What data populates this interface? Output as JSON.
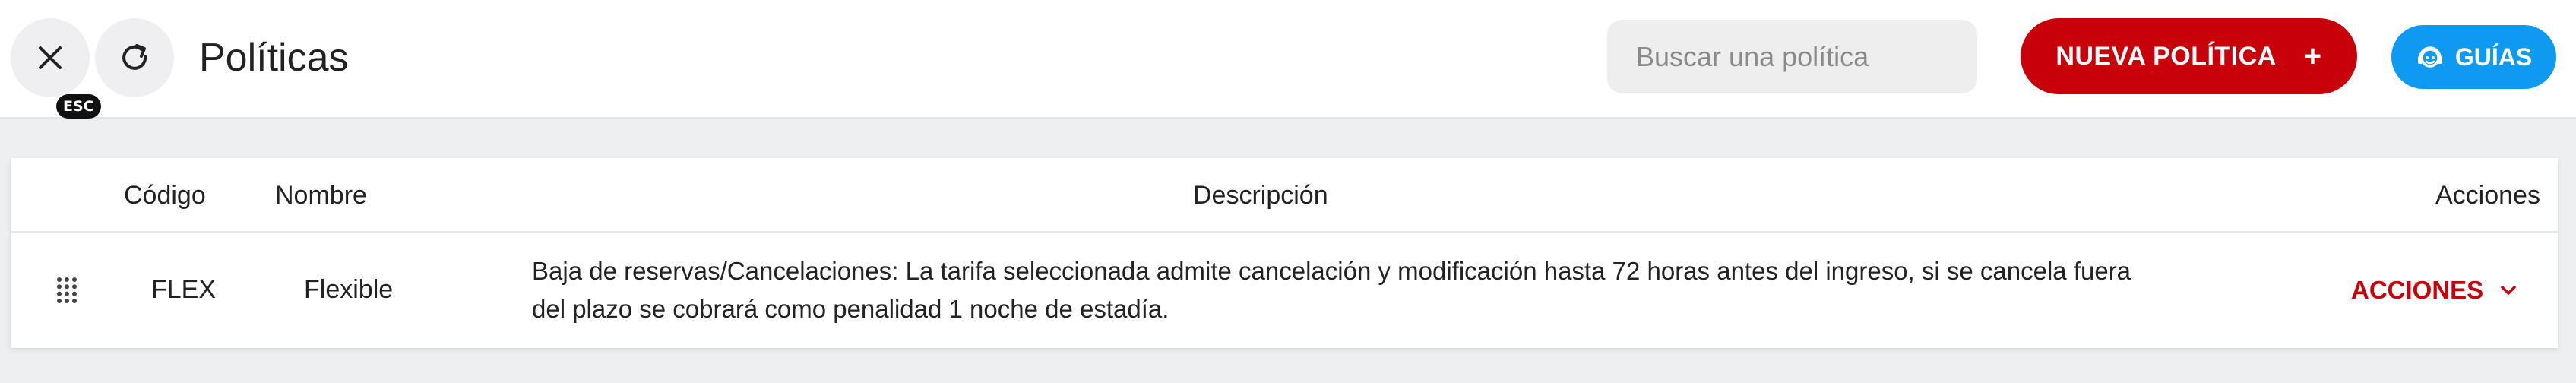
{
  "header": {
    "esc_label": "ESC",
    "title": "Políticas",
    "search_placeholder": "Buscar una política",
    "new_policy_label": "NUEVA POLÍTICA",
    "new_policy_icon": "+",
    "guides_label": "GUÍAS"
  },
  "colors": {
    "primary_red": "#c8000a",
    "guides_blue": "#0d9af0",
    "background": "#eeeff1"
  },
  "icons": {
    "close": "close-icon",
    "refresh": "refresh-icon",
    "guides": "support-agent-icon",
    "drag": "drag-handle-icon",
    "dropdown": "chevron-down-icon"
  },
  "table": {
    "columns": {
      "code": "Código",
      "name": "Nombre",
      "description": "Descripción",
      "actions": "Acciones"
    },
    "rows": [
      {
        "code": "FLEX",
        "name": "Flexible",
        "description": "Baja de reservas/Cancelaciones: La tarifa seleccionada admite cancelación y modificación hasta 72 horas antes del ingreso, si se cancela fuera del plazo se cobrará como penalidad 1 noche de estadía.",
        "actions_label": "ACCIONES"
      }
    ]
  }
}
